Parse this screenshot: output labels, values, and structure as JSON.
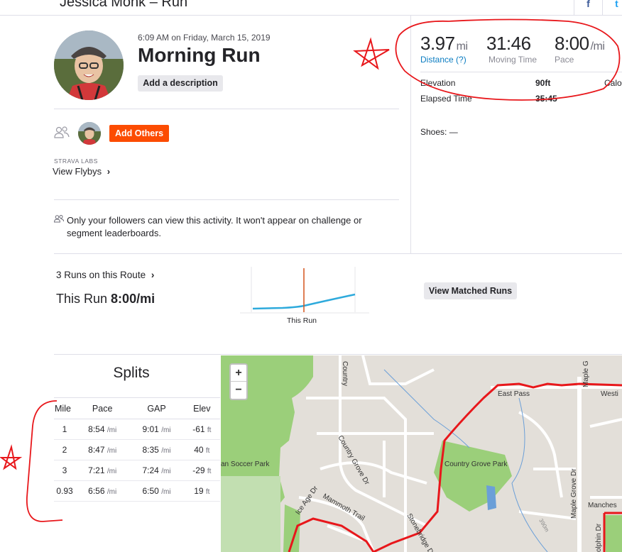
{
  "header": {
    "title": "Jessica Monk – Run",
    "share_facebook": "f",
    "share_twitter": "t"
  },
  "activity": {
    "time": "6:09 AM on Friday, March 15, 2019",
    "title": "Morning Run",
    "add_description_label": "Add a description",
    "add_others_label": "Add Others",
    "labs_label": "STRAVA LABS",
    "flybys_label": "View Flybys",
    "privacy_text": "Only your followers can view this activity. It won't appear on challenge or segment leaderboards."
  },
  "stats": {
    "distance": {
      "value": "3.97",
      "unit": "mi",
      "label": "Distance (?)"
    },
    "moving_time": {
      "value": "31:46",
      "label": "Moving Time"
    },
    "pace": {
      "value": "8:00",
      "unit": "/mi",
      "label": "Pace"
    },
    "elevation_label": "Elevation",
    "elevation_value": "90ft",
    "calories_label": "Calor",
    "elapsed_label": "Elapsed Time",
    "elapsed_value": "35:45",
    "shoes_label": "Shoes: —"
  },
  "route": {
    "runs_label": "3 Runs on this Route",
    "this_run_prefix": "This Run",
    "this_run_pace": "8:00/mi",
    "chart_label": "This Run",
    "matched_button": "View Matched Runs",
    "line_color": "#2eaadc",
    "marker_color": "#d4531b"
  },
  "splits": {
    "title": "Splits",
    "columns": [
      "Mile",
      "Pace",
      "GAP",
      "Elev"
    ],
    "rows": [
      {
        "mile": "1",
        "pace": "8:54",
        "pace_unit": "/mi",
        "gap": "9:01",
        "gap_unit": "/mi",
        "elev": "-61",
        "elev_unit": "ft"
      },
      {
        "mile": "2",
        "pace": "8:47",
        "pace_unit": "/mi",
        "gap": "8:35",
        "gap_unit": "/mi",
        "elev": "40",
        "elev_unit": "ft"
      },
      {
        "mile": "3",
        "pace": "7:21",
        "pace_unit": "/mi",
        "gap": "7:24",
        "gap_unit": "/mi",
        "elev": "-29",
        "elev_unit": "ft"
      },
      {
        "mile": "0.93",
        "pace": "6:56",
        "pace_unit": "/mi",
        "gap": "6:50",
        "gap_unit": "/mi",
        "elev": "19",
        "elev_unit": "ft"
      }
    ]
  },
  "map": {
    "zoom_in": "+",
    "zoom_out": "−",
    "labels": {
      "country_grove_dr": "Country Grove Dr",
      "country_grove_park": "Country Grove Park",
      "soccer_park": "an Soccer Park",
      "mammoth_trail": "Mammoth Trail",
      "ice_age_dr": "Ice Age Dr",
      "stonebridge_dr": "Stonebridge Dr",
      "east_pass": "East Pass",
      "maple_grove_dr": "Maple Grove Dr",
      "maple_g": "Maple G",
      "westi": "Westi",
      "manches": "Manches",
      "dolphin_dr": "olphin Dr",
      "country": "Country",
      "contour": "390m"
    },
    "route_color": "#e8171b",
    "park_color": "#9bcf7a",
    "water_color": "#6b9fd8"
  },
  "annotations": {
    "color": "#e8171b"
  }
}
